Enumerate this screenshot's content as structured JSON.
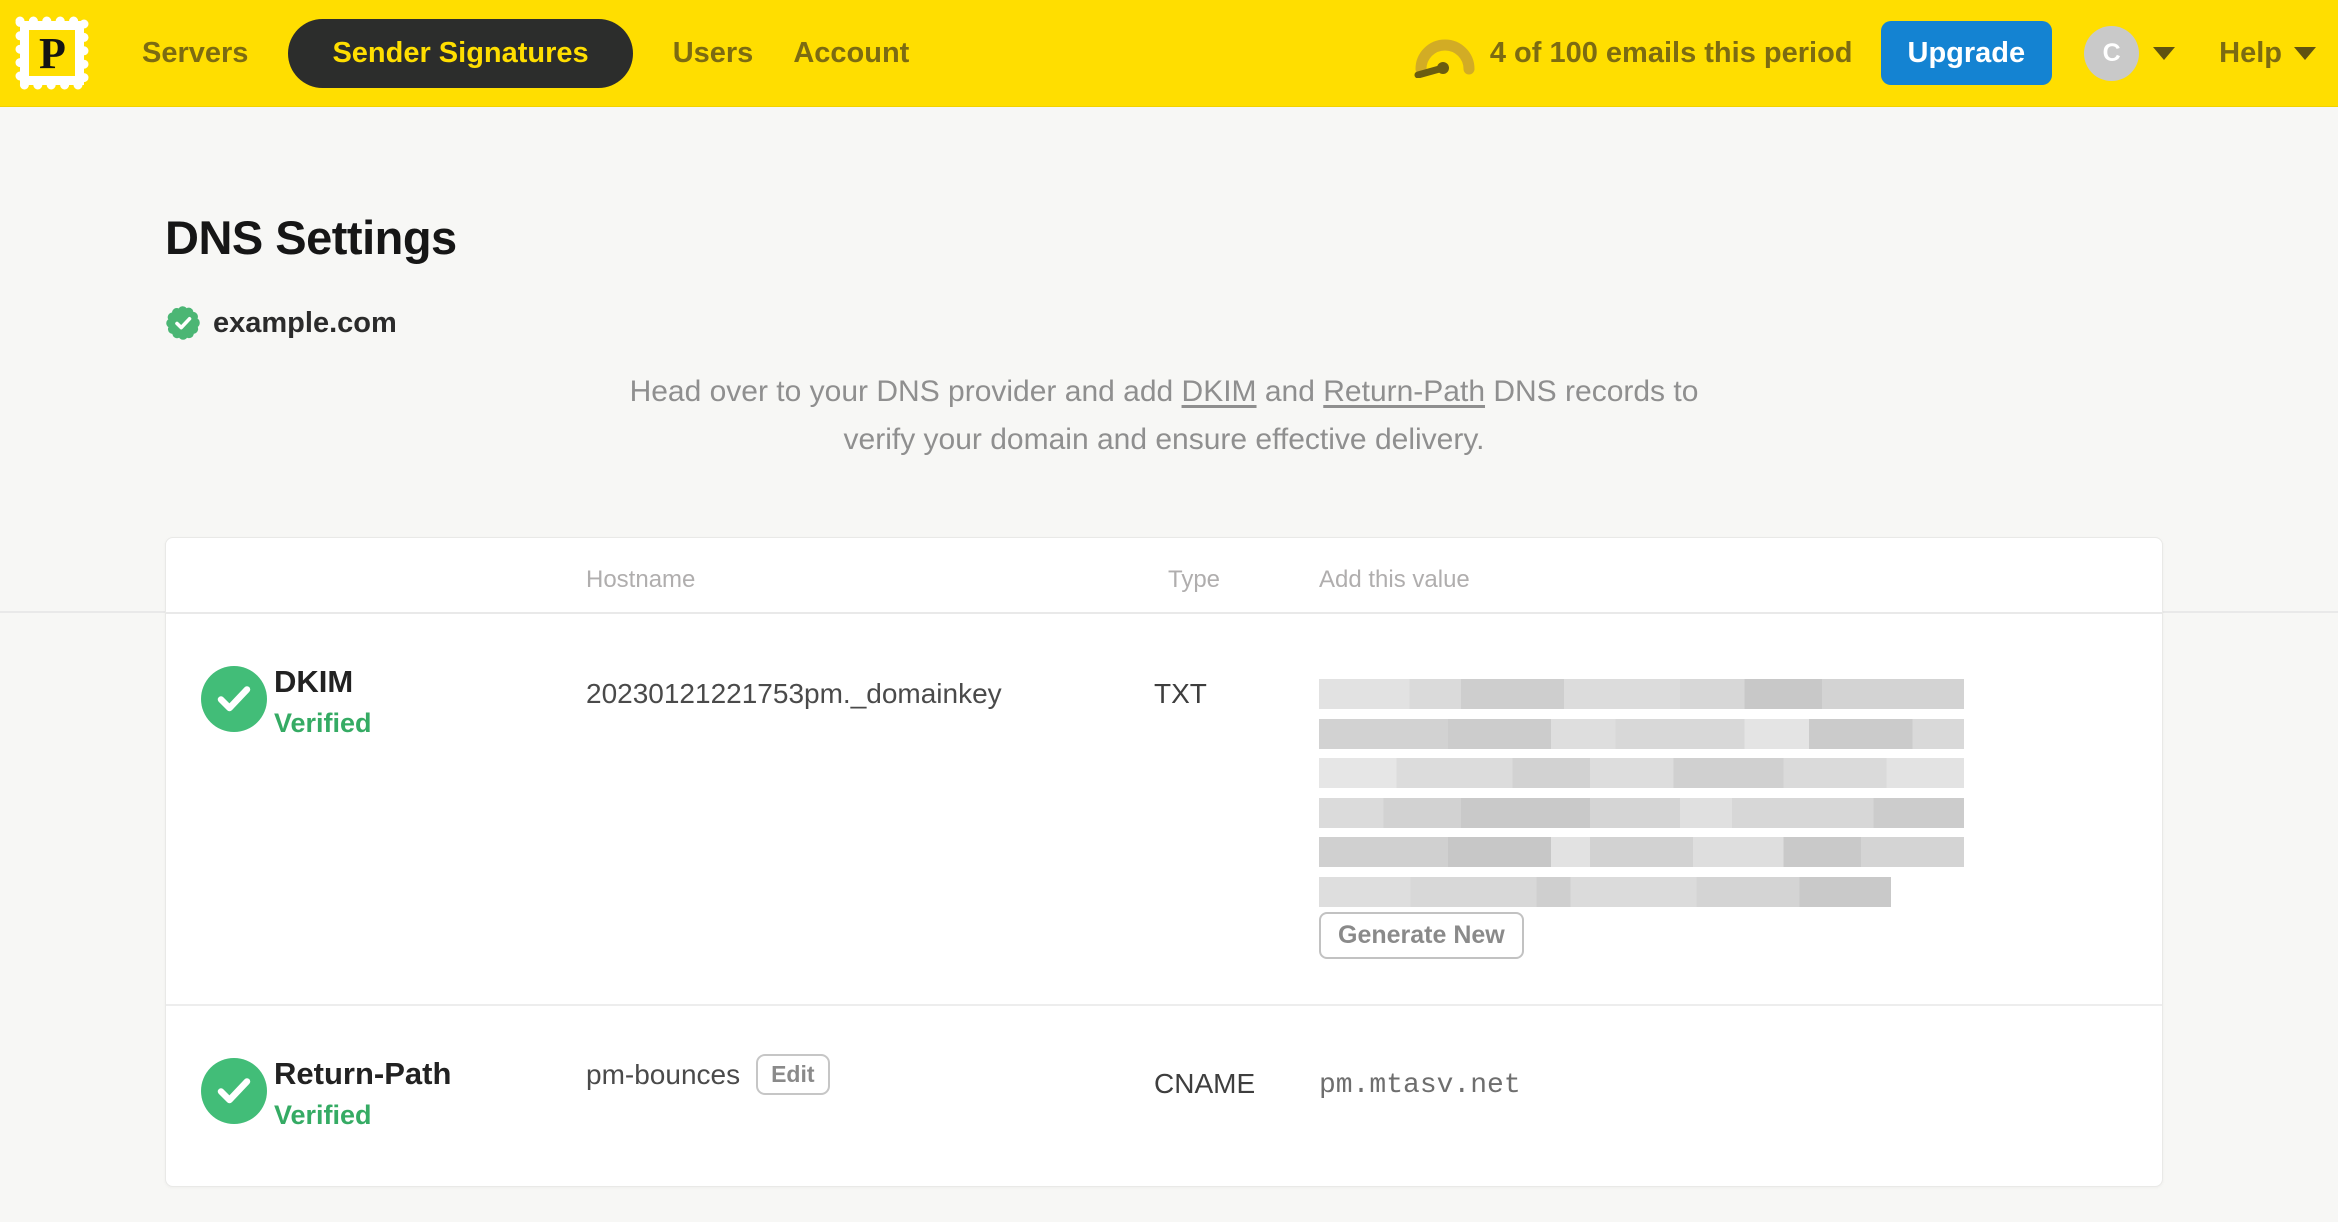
{
  "nav": {
    "logo_letter": "P",
    "items": [
      {
        "label": "Servers",
        "active": false
      },
      {
        "label": "Sender Signatures",
        "active": true
      },
      {
        "label": "Users",
        "active": false
      },
      {
        "label": "Account",
        "active": false
      }
    ],
    "usage_text": "4 of 100 emails this period",
    "upgrade_label": "Upgrade",
    "avatar_initial": "C",
    "help_label": "Help"
  },
  "page": {
    "title": "DNS Settings",
    "domain": "example.com",
    "intro": {
      "text_before_dkim": "Head over to your DNS provider and add ",
      "dkim_link": "DKIM",
      "text_between": " and ",
      "return_path_link": "Return-Path",
      "text_after": " DNS records to",
      "line2": "verify your domain and ensure effective delivery."
    }
  },
  "table": {
    "headers": {
      "hostname": "Hostname",
      "type": "Type",
      "value": "Add this value"
    },
    "rows": [
      {
        "name": "DKIM",
        "status": "Verified",
        "hostname": "20230121221753pm._domainkey",
        "type": "TXT",
        "value_redacted": true,
        "redacted_lines": 6,
        "action": "Generate New"
      },
      {
        "name": "Return-Path",
        "status": "Verified",
        "hostname": "pm-bounces",
        "hostname_action": "Edit",
        "type": "CNAME",
        "value": "pm.mtasv.net"
      }
    ]
  },
  "colors": {
    "brand_yellow": "#ffde00",
    "nav_text_olive": "#7c6b12",
    "pill_dark": "#2c2d2c",
    "upgrade_blue": "#1483d2",
    "verified_green": "#42bd78",
    "status_green_text": "#35ab64"
  }
}
